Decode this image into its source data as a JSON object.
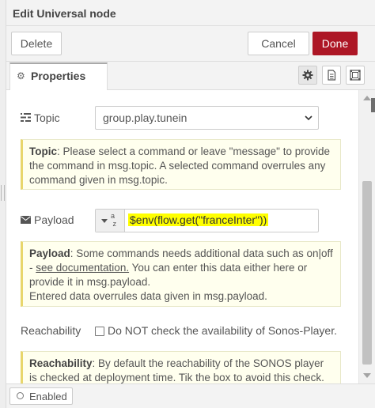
{
  "dialog": {
    "title": "Edit Universal node",
    "delete_label": "Delete",
    "cancel_label": "Cancel",
    "done_label": "Done"
  },
  "tabs": {
    "properties_label": "Properties",
    "icons": [
      "gear-icon",
      "description-icon",
      "appearance-icon"
    ]
  },
  "form": {
    "topic_label": "Topic",
    "topic_value": "group.play.tunein",
    "topic_note": {
      "bold": "Topic",
      "text": ": Please select a command or leave \"message\" to provide the command in msg.topic. A selected command overrules any command given in msg.topic."
    },
    "payload_label": "Payload",
    "payload_type_icon": "az",
    "payload_value": "$env(flow.get(\"franceInter\"))",
    "payload_note": {
      "bold": "Payload",
      "text1": ": Some commands needs additional data such as on|off - ",
      "link": "see documentation.",
      "text2": " You can enter this data either here or provide it in msg.payload.",
      "text3": "Entered data overrules data given in msg.payload."
    },
    "reachability_label": "Reachability",
    "reachability_checkbox_label": "Do NOT check the availability of Sonos-Player.",
    "reachability_checked": false,
    "reachability_note": {
      "bold": "Reachability",
      "text": ": By default the reachability of the SONOS player is checked at deployment time. Tik the box to avoid this check. That"
    }
  },
  "footer": {
    "enabled_label": "Enabled"
  },
  "colors": {
    "done_button": "#ad1625",
    "note_background": "#ffffee",
    "note_border": "#e8d66c",
    "highlight": "#ffff00"
  }
}
